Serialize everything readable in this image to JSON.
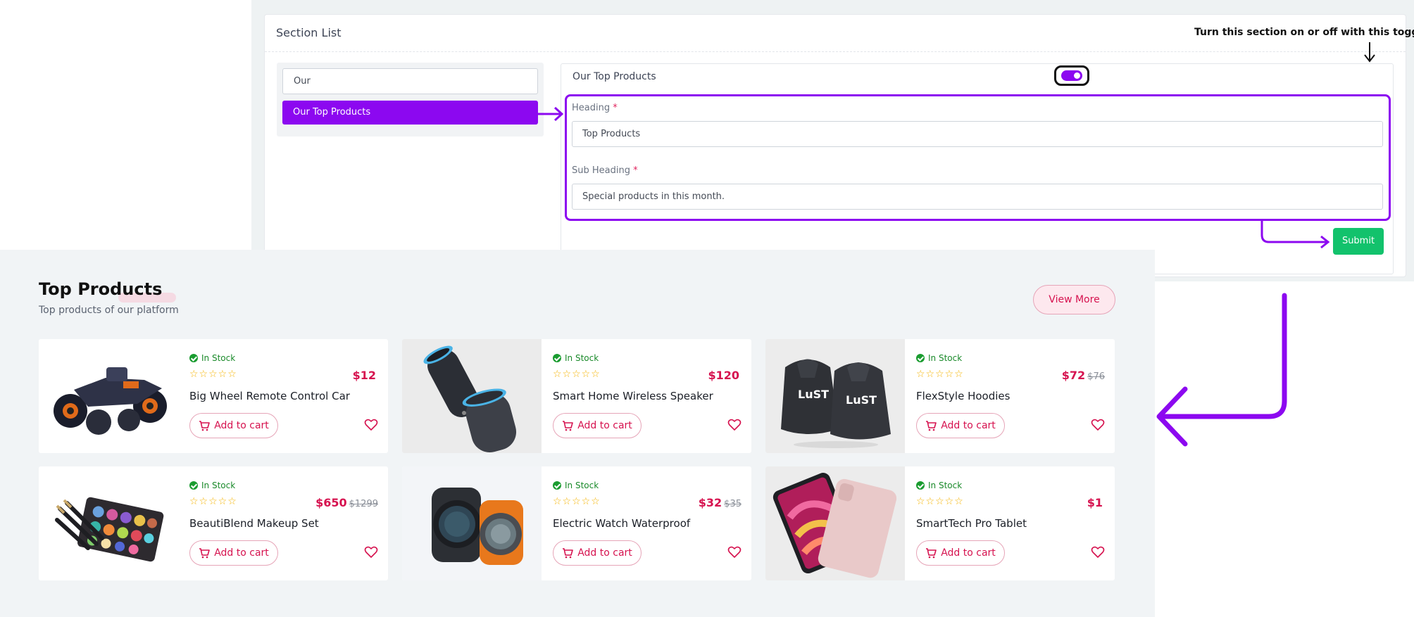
{
  "admin": {
    "section_list_title": "Section List",
    "search": {
      "value": "Our",
      "placeholder": ""
    },
    "active_item": "Our Top Products",
    "editor": {
      "title": "Our Top Products",
      "toggle_on": true,
      "heading_label": "Heading",
      "heading_value": "Top Products",
      "subheading_label": "Sub Heading",
      "subheading_value": "Special products in this month.",
      "required_mark": "*",
      "submit_label": "Submit"
    },
    "annotation": "Turn this section on or off with this toggle"
  },
  "store": {
    "title": "Top Products",
    "subtitle": "Top products of our platform",
    "view_more_label": "View More",
    "stock_label": "In Stock",
    "stars": "☆☆☆☆☆",
    "cart_label": "Add to cart",
    "products": [
      {
        "name": "Big Wheel Remote Control Car",
        "price": "$12",
        "old_price": "",
        "image": "rc-car"
      },
      {
        "name": "Smart Home Wireless Speaker",
        "price": "$120",
        "old_price": "",
        "image": "speaker"
      },
      {
        "name": "FlexStyle Hoodies",
        "price": "$72",
        "old_price": "$76",
        "image": "hoodies"
      },
      {
        "name": "BeautiBlend Makeup Set",
        "price": "$650",
        "old_price": "$1299",
        "image": "makeup"
      },
      {
        "name": "Electric Watch Waterproof",
        "price": "$32",
        "old_price": "$35",
        "image": "watch"
      },
      {
        "name": "SmartTech Pro Tablet",
        "price": "$1",
        "old_price": "",
        "image": "tablet"
      }
    ]
  },
  "colors": {
    "brand_purple": "#8c08f0",
    "accent_pink": "#d6124f",
    "success_green": "#12c26c",
    "stock_green": "#1a8a2a",
    "star_yellow": "#f5b301"
  }
}
